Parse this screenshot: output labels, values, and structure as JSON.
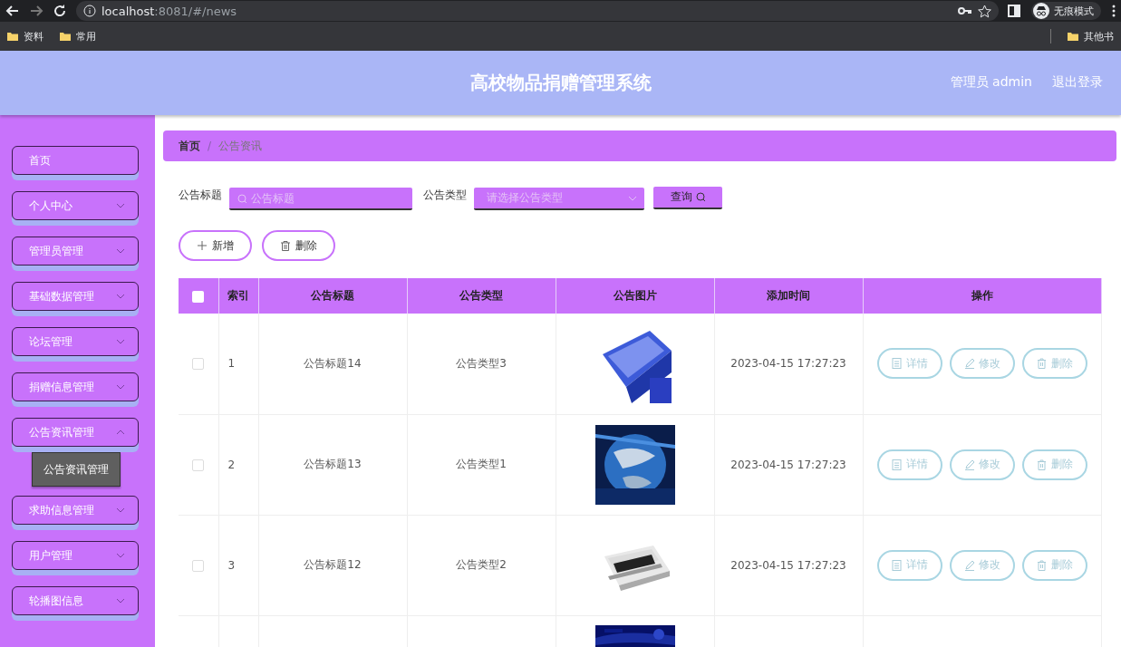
{
  "browser": {
    "url_host": "localhost",
    "url_rest": ":8081/#/news",
    "incognito_label": "无痕模式",
    "bookmarks": [
      "资料",
      "常用"
    ],
    "other_bookmarks": "其他书"
  },
  "header": {
    "title": "高校物品捐赠管理系统",
    "user": "管理员 admin",
    "logout": "退出登录"
  },
  "sidebar": {
    "items": [
      {
        "label": "首页",
        "kind": "link"
      },
      {
        "label": "个人中心",
        "kind": "menu",
        "expanded": false
      },
      {
        "label": "管理员管理",
        "kind": "menu",
        "expanded": false
      },
      {
        "label": "基础数据管理",
        "kind": "menu",
        "expanded": false
      },
      {
        "label": "论坛管理",
        "kind": "menu",
        "expanded": false
      },
      {
        "label": "捐赠信息管理",
        "kind": "menu",
        "expanded": false
      },
      {
        "label": "公告资讯管理",
        "kind": "menu",
        "expanded": true,
        "children": [
          {
            "label": "公告资讯管理",
            "selected": true
          }
        ]
      },
      {
        "label": "求助信息管理",
        "kind": "menu",
        "expanded": false
      },
      {
        "label": "用户管理",
        "kind": "menu",
        "expanded": false
      },
      {
        "label": "轮播图信息",
        "kind": "menu",
        "expanded": false
      }
    ]
  },
  "breadcrumb": {
    "separator": "/",
    "items": [
      {
        "label": "首页",
        "current": false
      },
      {
        "label": "公告资讯",
        "current": true
      }
    ]
  },
  "filters": {
    "title_label": "公告标题",
    "title_placeholder": "公告标题",
    "type_label": "公告类型",
    "type_placeholder": "请选择公告类型",
    "search_button": "查询"
  },
  "actions": {
    "add": "新增",
    "delete": "删除"
  },
  "table": {
    "all_checked": false,
    "columns": [
      "索引",
      "公告标题",
      "公告类型",
      "公告图片",
      "添加时间",
      "操作"
    ],
    "rows": [
      {
        "selected": false,
        "index": "1",
        "title": "公告标题14",
        "type": "公告类型3",
        "image": {
          "kind": "picture"
        },
        "time": "2023-04-15 17:27:23",
        "buttons": [
          "详情",
          "修改",
          "删除"
        ]
      },
      {
        "selected": false,
        "index": "2",
        "title": "公告标题13",
        "type": "公告类型1",
        "image": {
          "kind": "picture"
        },
        "time": "2023-04-15 17:27:23",
        "buttons": [
          "详情",
          "修改",
          "删除"
        ]
      },
      {
        "selected": false,
        "index": "3",
        "title": "公告标题12",
        "type": "公告类型2",
        "image": {
          "kind": "picture"
        },
        "time": "2023-04-15 17:27:23",
        "buttons": [
          "详情",
          "修改",
          "删除"
        ]
      },
      {
        "image": {
          "kind": "picture"
        }
      }
    ]
  }
}
